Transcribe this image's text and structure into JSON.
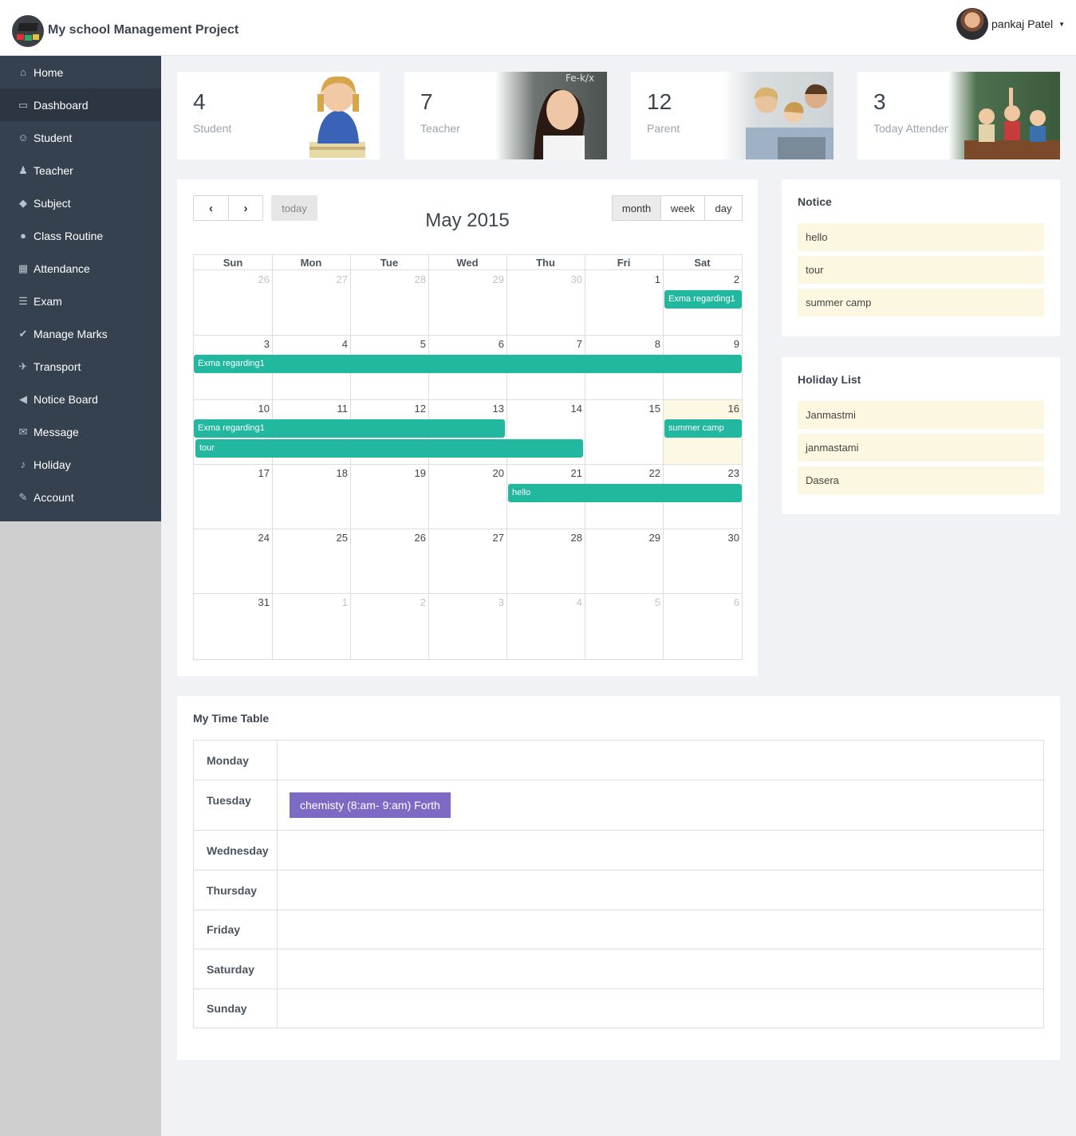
{
  "header": {
    "app_title": "My school Management Project",
    "user_name": "pankaj Patel"
  },
  "sidebar": {
    "items": [
      {
        "label": "Home",
        "icon": "home-icon"
      },
      {
        "label": "Dashboard",
        "icon": "dashboard-icon"
      },
      {
        "label": "Student",
        "icon": "student-icon"
      },
      {
        "label": "Teacher",
        "icon": "teacher-icon"
      },
      {
        "label": "Subject",
        "icon": "subject-icon"
      },
      {
        "label": "Class Routine",
        "icon": "map-pin-icon"
      },
      {
        "label": "Attendance",
        "icon": "table-icon"
      },
      {
        "label": "Exam",
        "icon": "list-icon"
      },
      {
        "label": "Manage Marks",
        "icon": "check-circle-icon"
      },
      {
        "label": "Transport",
        "icon": "plane-icon"
      },
      {
        "label": "Notice Board",
        "icon": "bullhorn-icon"
      },
      {
        "label": "Message",
        "icon": "envelope-icon"
      },
      {
        "label": "Holiday",
        "icon": "bell-icon"
      },
      {
        "label": "Account",
        "icon": "pencil-icon"
      }
    ],
    "active_index": 1
  },
  "stats": [
    {
      "value": "4",
      "label": "Student"
    },
    {
      "value": "7",
      "label": "Teacher"
    },
    {
      "value": "12",
      "label": "Parent"
    },
    {
      "value": "3",
      "label": "Today Attendence"
    }
  ],
  "calendar": {
    "title": "May 2015",
    "today_button": "today",
    "views": [
      "month",
      "week",
      "day"
    ],
    "active_view": "month",
    "weekdays": [
      "Sun",
      "Mon",
      "Tue",
      "Wed",
      "Thu",
      "Fri",
      "Sat"
    ],
    "weeks": [
      [
        "26",
        "27",
        "28",
        "29",
        "30",
        "1",
        "2"
      ],
      [
        "3",
        "4",
        "5",
        "6",
        "7",
        "8",
        "9"
      ],
      [
        "10",
        "11",
        "12",
        "13",
        "14",
        "15",
        "16"
      ],
      [
        "17",
        "18",
        "19",
        "20",
        "21",
        "22",
        "23"
      ],
      [
        "24",
        "25",
        "26",
        "27",
        "28",
        "29",
        "30"
      ],
      [
        "31",
        "1",
        "2",
        "3",
        "4",
        "5",
        "6"
      ]
    ],
    "other_month": [
      [
        0,
        0
      ],
      [
        0,
        1
      ],
      [
        0,
        2
      ],
      [
        0,
        3
      ],
      [
        0,
        4
      ],
      [
        5,
        1
      ],
      [
        5,
        2
      ],
      [
        5,
        3
      ],
      [
        5,
        4
      ],
      [
        5,
        5
      ],
      [
        5,
        6
      ]
    ],
    "today": [
      2,
      6
    ],
    "events": [
      {
        "title": "Exma regarding1",
        "week": 0,
        "start": 6,
        "end": 6,
        "lane": 0
      },
      {
        "title": "Exma regarding1",
        "week": 1,
        "start": 0,
        "end": 6,
        "lane": 0
      },
      {
        "title": "Exma regarding1",
        "week": 2,
        "start": 0,
        "end": 3,
        "lane": 0
      },
      {
        "title": "tour",
        "week": 2,
        "start": 0,
        "end": 4,
        "lane": 1
      },
      {
        "title": "summer camp",
        "week": 2,
        "start": 6,
        "end": 6,
        "lane": 0
      },
      {
        "title": "hello",
        "week": 3,
        "start": 4,
        "end": 6,
        "lane": 0
      }
    ]
  },
  "notice": {
    "title": "Notice",
    "items": [
      "hello",
      "tour",
      "summer camp"
    ]
  },
  "holiday": {
    "title": "Holiday List",
    "items": [
      "Janmastmi",
      "janmastami",
      "Dasera"
    ]
  },
  "timetable": {
    "title": "My Time Table",
    "days": [
      "Monday",
      "Tuesday",
      "Wednesday",
      "Thursday",
      "Friday",
      "Saturday",
      "Sunday"
    ],
    "entries": {
      "Tuesday": "chemisty (8:am- 9:am) Forth"
    }
  },
  "colors": {
    "event": "#22b8a0",
    "timetable_chip": "#7d6ac5",
    "sidebar": "#364150",
    "today_cell": "#fcf8e3"
  }
}
